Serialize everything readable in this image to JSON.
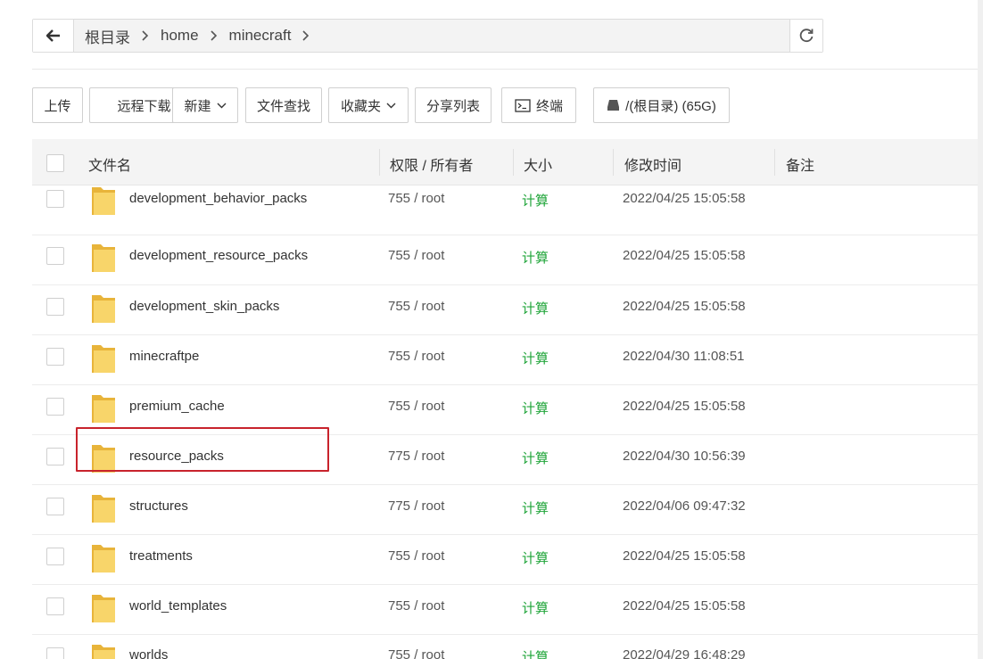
{
  "breadcrumb": {
    "items": [
      "根目录",
      "home",
      "minecraft"
    ]
  },
  "toolbar": {
    "upload": "上传",
    "remote_download": "远程下载",
    "new": "新建",
    "file_search": "文件查找",
    "favorites": "收藏夹",
    "share_list": "分享列表",
    "terminal": "终端",
    "disk": "/(根目录) (65G)"
  },
  "table": {
    "headers": {
      "name": "文件名",
      "perm": "权限 / 所有者",
      "size": "大小",
      "mtime": "修改时间",
      "note": "备注"
    },
    "rows": [
      {
        "name": "development_behavior_packs",
        "perm": "755 / root",
        "size": "计算",
        "mtime": "2022/04/25 15:05:58"
      },
      {
        "name": "development_resource_packs",
        "perm": "755 / root",
        "size": "计算",
        "mtime": "2022/04/25 15:05:58"
      },
      {
        "name": "development_skin_packs",
        "perm": "755 / root",
        "size": "计算",
        "mtime": "2022/04/25 15:05:58"
      },
      {
        "name": "minecraftpe",
        "perm": "755 / root",
        "size": "计算",
        "mtime": "2022/04/30 11:08:51"
      },
      {
        "name": "premium_cache",
        "perm": "755 / root",
        "size": "计算",
        "mtime": "2022/04/25 15:05:58"
      },
      {
        "name": "resource_packs",
        "perm": "775 / root",
        "size": "计算",
        "mtime": "2022/04/30 10:56:39"
      },
      {
        "name": "structures",
        "perm": "775 / root",
        "size": "计算",
        "mtime": "2022/04/06 09:47:32"
      },
      {
        "name": "treatments",
        "perm": "755 / root",
        "size": "计算",
        "mtime": "2022/04/25 15:05:58"
      },
      {
        "name": "world_templates",
        "perm": "755 / root",
        "size": "计算",
        "mtime": "2022/04/25 15:05:58"
      },
      {
        "name": "worlds",
        "perm": "755 / root",
        "size": "计算",
        "mtime": "2022/04/29 16:48:29"
      }
    ]
  },
  "colors": {
    "size_link": "#20a53a",
    "highlight_border": "#c8232c",
    "folder": "#f5c84c"
  }
}
